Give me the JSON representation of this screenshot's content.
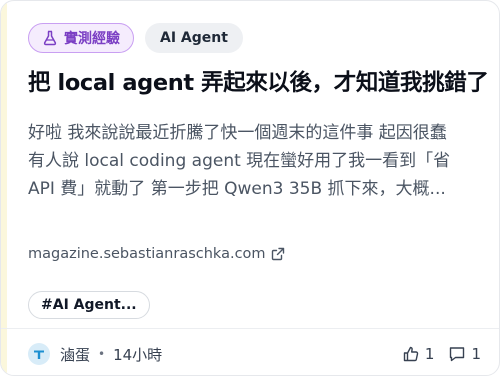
{
  "card": {
    "category_tag": {
      "label": "實測經驗",
      "icon": "flask-icon",
      "color": "#7b3fc4"
    },
    "topic_tag": {
      "label": "AI Agent"
    },
    "title": "把 local agent 弄起來以後，才知道我挑錯了",
    "excerpt_lines": [
      "好啦 我來說說最近折騰了快一個週末的這件事 起因很蠢",
      "有人說 local coding agent 現在蠻好用了我一看到「省",
      "API 費」就動了 第一步把 Qwen3 35B 抓下來，大概..."
    ],
    "source_link": {
      "text": "magazine.sebastianraschka.com",
      "icon": "external-link-icon"
    },
    "hashtag": "#AI Agent...",
    "footer": {
      "avatar_icon": "t-avatar-icon",
      "author": "滷蛋",
      "separator": "•",
      "time": "14小時",
      "likes": "1",
      "comments": "1"
    }
  }
}
